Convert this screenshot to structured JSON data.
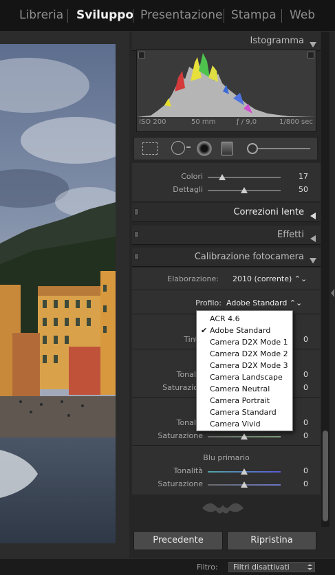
{
  "modules": [
    {
      "label": "Libreria",
      "active": false
    },
    {
      "label": "Sviluppo",
      "active": true
    },
    {
      "label": "Presentazione",
      "active": false
    },
    {
      "label": "Stampa",
      "active": false
    },
    {
      "label": "Web",
      "active": false
    }
  ],
  "histogram": {
    "title": "Istogramma",
    "iso": "ISO 200",
    "focal": "50 mm",
    "aperture": "ƒ / 9,0",
    "shutter": "1/800 sec"
  },
  "detail": {
    "colors_label": "Colori",
    "colors_value": "17",
    "detail_label": "Dettagli",
    "detail_value": "50"
  },
  "panels": {
    "lens": "Correzioni lente",
    "effects": "Effetti",
    "calibration": "Calibrazione fotocamera"
  },
  "calibration": {
    "process_label": "Elaborazione:",
    "process_value": "2010 (corrente) ⌃⌄",
    "profile_label": "Profilo:",
    "profile_value": "Adobe Standard ⌃⌄",
    "tint_label": "Tint",
    "tint_value": "0",
    "red_hue_label": "Tonali",
    "red_hue_value": "0",
    "red_sat_label": "Saturazio",
    "red_sat_value": "0",
    "green_hue_label": "Tonali",
    "green_hue_value": "0",
    "green_sat_label": "Saturazione",
    "green_sat_value": "0",
    "blue_title": "Blu primario",
    "blue_hue_label": "Tonalità",
    "blue_hue_value": "0",
    "blue_sat_label": "Saturazione",
    "blue_sat_value": "0"
  },
  "profile_options": [
    {
      "label": "ACR 4.6",
      "checked": false
    },
    {
      "label": "Adobe Standard",
      "checked": true
    },
    {
      "label": "Camera D2X Mode 1",
      "checked": false
    },
    {
      "label": "Camera D2X Mode 2",
      "checked": false
    },
    {
      "label": "Camera D2X Mode 3",
      "checked": false
    },
    {
      "label": "Camera Landscape",
      "checked": false
    },
    {
      "label": "Camera Neutral",
      "checked": false
    },
    {
      "label": "Camera Portrait",
      "checked": false
    },
    {
      "label": "Camera Standard",
      "checked": false
    },
    {
      "label": "Camera Vivid",
      "checked": false
    }
  ],
  "buttons": {
    "previous": "Precedente",
    "reset": "Ripristina"
  },
  "statusbar": {
    "filter_label": "Filtro:",
    "filter_value": "Filtri disattivati"
  },
  "colors": {
    "panel_bg": "#262626",
    "active_module": "#f0f0f0",
    "inactive_module": "#8e8e8e"
  }
}
